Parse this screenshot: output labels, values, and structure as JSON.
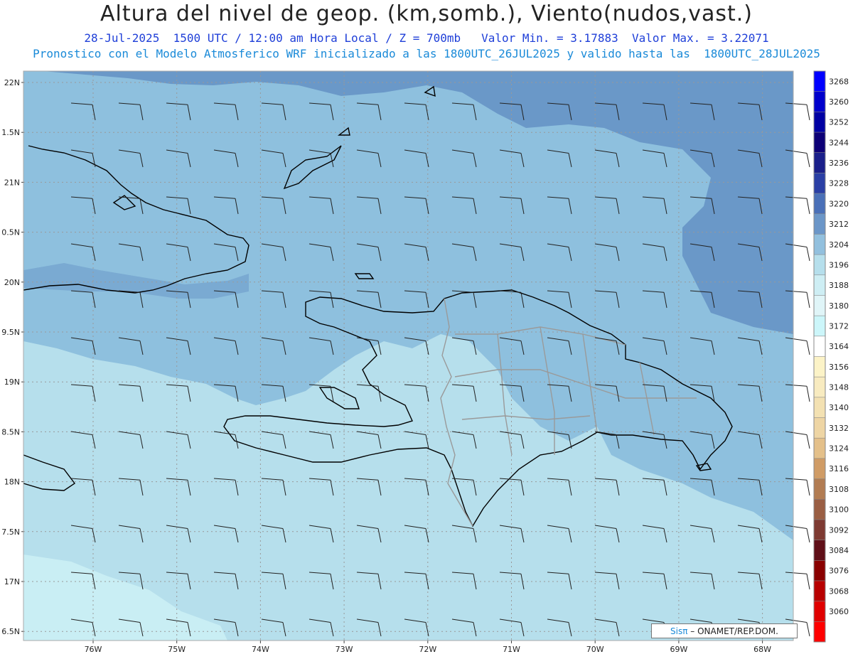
{
  "title": "Altura del nivel de geop. (km,somb.), Viento(nudos,vast.)",
  "subtitle_1": "28-Jul-2025  1500 UTC / 12:00 am Hora Local / Z = 700mb   Valor Min. = 3.17883  Valor Max. = 3.22071",
  "subtitle_2": "Pronostico con el Modelo Atmosferico WRF inicializado a las 1800UTC_26JUL2025 y valido hasta las  1800UTC_28JUL2025",
  "credit": {
    "brand": "Sisπ",
    "text": " – ONAMET/REP.DOM."
  },
  "lat_labels": [
    "22N",
    "1.5N",
    "21N",
    "0.5N",
    "20N",
    "9.5N",
    "19N",
    "8.5N",
    "18N",
    "7.5N",
    "17N",
    "6.5N"
  ],
  "lon_labels": [
    "76W",
    "75W",
    "74W",
    "73W",
    "72W",
    "71W",
    "70W",
    "69W",
    "68W"
  ],
  "colorbar": {
    "labels": [
      "3268",
      "3260",
      "3252",
      "3244",
      "3236",
      "3228",
      "3220",
      "3212",
      "3204",
      "3196",
      "3188",
      "3180",
      "3172",
      "3164",
      "3156",
      "3148",
      "3140",
      "3132",
      "3124",
      "3116",
      "3108",
      "3100",
      "3092",
      "3084",
      "3076",
      "3068",
      "3060"
    ],
    "colors": [
      "#0000ff",
      "#0000cc",
      "#0000a3",
      "#0d0077",
      "#1a1f8a",
      "#2a3fa5",
      "#4a70b8",
      "#6b96c8",
      "#92c0de",
      "#b6dfec",
      "#ceeef4",
      "#e0f5f8",
      "#ccf6fa",
      "#ffffff",
      "#fcf3c7",
      "#f8ebc0",
      "#f3e1b2",
      "#eed5a4",
      "#e4c08a",
      "#d09c66",
      "#b27c52",
      "#9a5e43",
      "#7e3a32",
      "#600f18",
      "#8a0000",
      "#b80000",
      "#e00000",
      "#ff0000"
    ]
  },
  "fill_colors": {
    "low": "#c9eef4",
    "mid": "#b6dfec",
    "high": "#8ec0de",
    "top": "#6a98c8"
  }
}
